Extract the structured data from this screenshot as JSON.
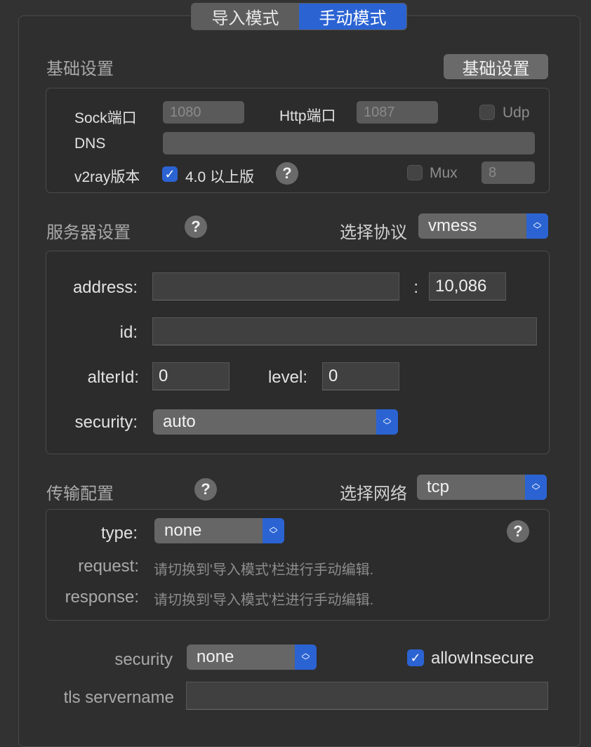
{
  "tabs": {
    "import": "导入模式",
    "manual": "手动模式"
  },
  "basic": {
    "title": "基础设置",
    "button": "基础设置",
    "sock_label": "Sock端口",
    "sock_value": "1080",
    "http_label": "Http端口",
    "http_value": "1087",
    "udp_label": "Udp",
    "dns_label": "DNS",
    "dns_value": "",
    "v2ray_label": "v2ray版本",
    "v2ray_check_label": "4.0 以上版",
    "mux_label": "Mux",
    "mux_value": "8",
    "check_mark": "✓",
    "help": "?"
  },
  "server": {
    "title": "服务器设置",
    "help": "?",
    "protocol_label": "选择协议",
    "protocol_value": "vmess",
    "address_label": "address:",
    "address_value": "",
    "colon": ":",
    "port_value": "10,086",
    "id_label": "id:",
    "id_value": "",
    "alterid_label": "alterId:",
    "alterid_value": "0",
    "level_label": "level:",
    "level_value": "0",
    "security_label": "security:",
    "security_value": "auto"
  },
  "transport": {
    "title": "传输配置",
    "help": "?",
    "network_label": "选择网络",
    "network_value": "tcp",
    "type_label": "type:",
    "type_value": "none",
    "type_help": "?",
    "request_label": "request:",
    "request_hint": "请切换到'导入模式'栏进行手动编辑.",
    "response_label": "response:",
    "response_hint": "请切换到'导入模式'栏进行手动编辑."
  },
  "tls": {
    "security_label": "security",
    "security_value": "none",
    "allow_insecure_label": "allowInsecure",
    "check_mark": "✓",
    "servername_label": "tls servername",
    "servername_value": ""
  },
  "colors": {
    "accent": "#2b63d3",
    "background": "#323232"
  }
}
